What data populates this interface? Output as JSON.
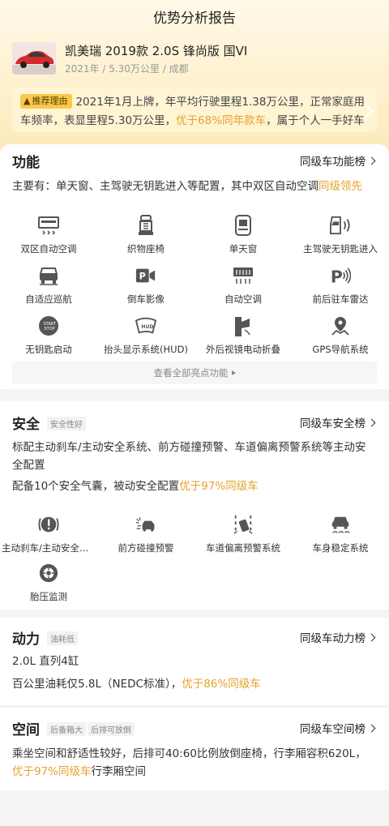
{
  "header": {
    "title": "优势分析报告"
  },
  "car": {
    "name": "凯美瑞 2019款 2.0S 锋尚版 国VI",
    "meta": "2021年 / 5.30万公里 / 成都"
  },
  "reason": {
    "tag": "推荐理由",
    "text_before": "2021年1月上牌，年平均行驶里程1.38万公里，正常家庭用车频率，表显里程5.30万公里，",
    "highlight": "优于68%同年款车",
    "text_after": "，属于个人一手好车"
  },
  "features": {
    "title": "功能",
    "rank_label": "同级车功能榜",
    "desc_before": "主要有：单天窗、主驾驶无钥匙进入等配置，其中双区自动空调",
    "desc_highlight": "同级领先",
    "items": [
      {
        "label": "双区自动空调",
        "icon": "dual-zone-ac-icon"
      },
      {
        "label": "织物座椅",
        "icon": "fabric-seat-icon"
      },
      {
        "label": "单天窗",
        "icon": "sunroof-icon"
      },
      {
        "label": "主驾驶无钥匙进入",
        "icon": "keyless-entry-icon"
      },
      {
        "label": "自适应巡航",
        "icon": "adaptive-cruise-icon"
      },
      {
        "label": "倒车影像",
        "icon": "reverse-camera-icon"
      },
      {
        "label": "自动空调",
        "icon": "auto-ac-icon"
      },
      {
        "label": "前后驻车雷达",
        "icon": "parking-radar-icon"
      },
      {
        "label": "无钥匙启动",
        "icon": "keyless-start-icon"
      },
      {
        "label": "抬头显示系统(HUD)",
        "icon": "hud-icon"
      },
      {
        "label": "外后视镜电动折叠",
        "icon": "mirror-fold-icon"
      },
      {
        "label": "GPS导航系统",
        "icon": "gps-icon"
      }
    ],
    "view_all": "查看全部亮点功能"
  },
  "safety": {
    "title": "安全",
    "tag": "安全性好",
    "rank_label": "同级车安全榜",
    "desc1": "标配主动刹车/主动安全系统、前方碰撞预警、车道偏离预警系统等主动安全配置",
    "desc2_before": "配备10个安全气囊，被动安全配置",
    "desc2_highlight": "优于97%同级车",
    "items": [
      {
        "label": "主动刹车/主动安全系统",
        "icon": "active-brake-icon"
      },
      {
        "label": "前方碰撞预警",
        "icon": "collision-warning-icon"
      },
      {
        "label": "车道偏离预警系统",
        "icon": "lane-departure-icon"
      },
      {
        "label": "车身稳定系统",
        "icon": "stability-icon"
      },
      {
        "label": "胎压监测",
        "icon": "tire-pressure-icon"
      }
    ]
  },
  "power": {
    "title": "动力",
    "tag": "油耗低",
    "rank_label": "同级车动力榜",
    "engine": "2.0L 直列4缸",
    "fuel_before": "百公里油耗仅5.8L（NEDC标准），",
    "fuel_highlight": "优于86%同级车"
  },
  "space": {
    "title": "空间",
    "tags": [
      "后备箱大",
      "后排可放倒"
    ],
    "rank_label": "同级车空间榜",
    "desc_before": "乘坐空间和舒适性较好，后排可40:60比例放倒座椅，行李厢容积620L，",
    "desc_highlight": "优于97%同级车",
    "desc_after": "行李厢空间"
  },
  "colors": {
    "highlight": "#e6a22b",
    "tag_bg": "#f8c94a",
    "icon": "#555555"
  }
}
